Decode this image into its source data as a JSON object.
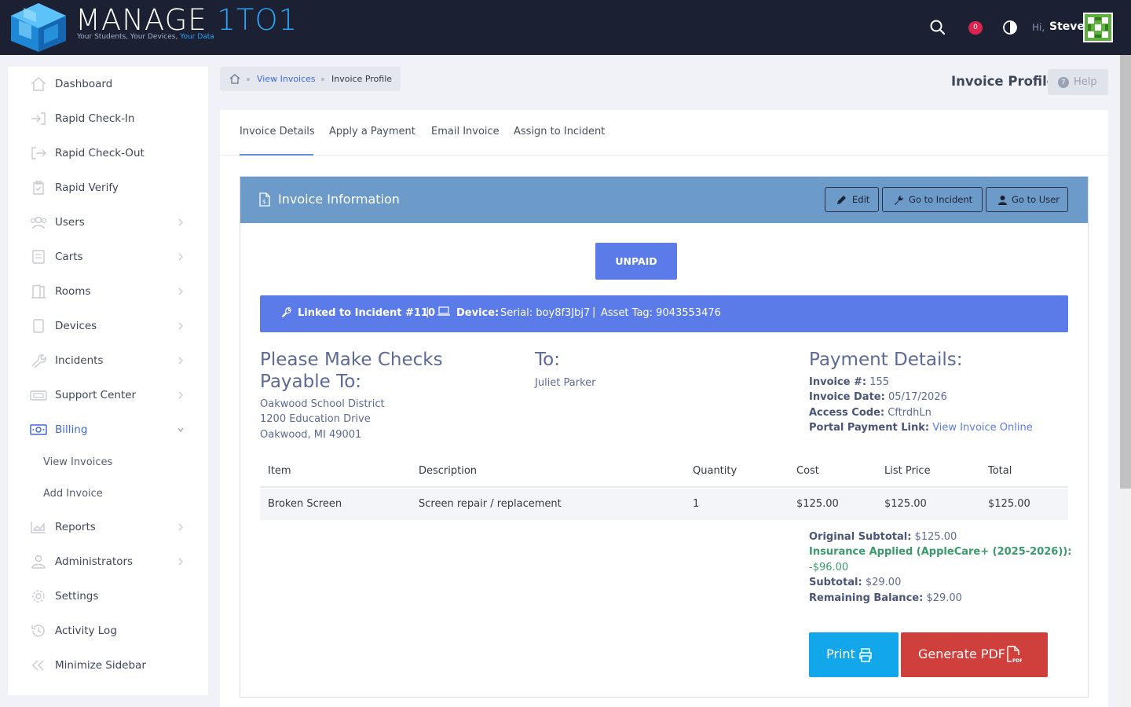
{
  "header": {
    "logo_main": "MANAGE ",
    "logo_accent": "1TO1",
    "logo_tagline": "Your Students, Your Devices, ",
    "logo_tagline_accent": "Your Data",
    "notification_count": "0",
    "greeting": "Hi,",
    "user_name": "Steve"
  },
  "sidebar": {
    "items": [
      {
        "label": "Dashboard",
        "icon": "home-icon",
        "has_children": false
      },
      {
        "label": "Rapid Check-In",
        "icon": "sign-in-icon",
        "has_children": false
      },
      {
        "label": "Rapid Check-Out",
        "icon": "sign-out-icon",
        "has_children": false
      },
      {
        "label": "Rapid Verify",
        "icon": "clipboard-check-icon",
        "has_children": false
      },
      {
        "label": "Users",
        "icon": "users-icon",
        "has_children": true
      },
      {
        "label": "Carts",
        "icon": "cart-icon",
        "has_children": true
      },
      {
        "label": "Rooms",
        "icon": "door-icon",
        "has_children": true
      },
      {
        "label": "Devices",
        "icon": "tablet-icon",
        "has_children": true
      },
      {
        "label": "Incidents",
        "icon": "wrench-icon",
        "has_children": true
      },
      {
        "label": "Support Center",
        "icon": "support-icon",
        "has_children": true
      },
      {
        "label": "Billing",
        "icon": "money-icon",
        "has_children": true,
        "active": true
      },
      {
        "label": "Reports",
        "icon": "chart-area-icon",
        "has_children": true
      },
      {
        "label": "Administrators",
        "icon": "admin-user-icon",
        "has_children": true
      },
      {
        "label": "Settings",
        "icon": "gear-icon",
        "has_children": false
      },
      {
        "label": "Activity Log",
        "icon": "history-icon",
        "has_children": false
      },
      {
        "label": "Minimize Sidebar",
        "icon": "double-chevron-left-icon",
        "has_children": false
      }
    ],
    "billing_sub": [
      "View Invoices",
      "Add Invoice"
    ]
  },
  "breadcrumb": {
    "link": "View Invoices",
    "current": "Invoice Profile"
  },
  "page": {
    "title": "Invoice Profile",
    "help_label": "Help"
  },
  "tabs": [
    "Invoice Details",
    "Apply a Payment",
    "Email Invoice",
    "Assign to Incident"
  ],
  "invoice_panel": {
    "title": "Invoice Information",
    "buttons": {
      "edit": "Edit",
      "incident": "Go to Incident",
      "user": "Go to User"
    },
    "status": "UNPAID",
    "link_bar": {
      "incident": "Linked to Incident #110",
      "sep": "|",
      "device_label": "Device:",
      "serial": "Serial: boy8f3Jbj7",
      "asset": "Asset Tag: 9043553476"
    },
    "payable": {
      "heading": "Please Make Checks Payable To:",
      "line1": "Oakwood School District",
      "line2": "1200 Education Drive",
      "line3": "Oakwood, MI 49001"
    },
    "to": {
      "heading": "To:",
      "name": "Juliet Parker"
    },
    "payment": {
      "heading": "Payment Details:",
      "invoice_no_label": "Invoice #:",
      "invoice_no": "155",
      "date_label": "Invoice Date:",
      "date": "05/17/2026",
      "access_label": "Access Code:",
      "access": "CftrdhLn",
      "portal_label": "Portal Payment Link:",
      "portal_link": "View Invoice Online"
    },
    "table": {
      "headers": [
        "Item",
        "Description",
        "Quantity",
        "Cost",
        "List Price",
        "Total"
      ],
      "rows": [
        [
          "Broken Screen",
          "Screen repair / replacement",
          "1",
          "$125.00",
          "$125.00",
          "$125.00"
        ]
      ]
    },
    "summary": {
      "original_label": "Original Subtotal:",
      "original": "$125.00",
      "insurance_label": "Insurance Applied (AppleCare+ (2025-2026)):",
      "insurance": "-$96.00",
      "subtotal_label": "Subtotal:",
      "subtotal": "$29.00",
      "remaining_label": "Remaining Balance:",
      "remaining": "$29.00"
    },
    "actions": {
      "print": "Print",
      "pdf": "Generate PDF"
    }
  },
  "colors": {
    "topbar": "#1c2033",
    "accent": "#3f6ad8",
    "panel_header": "#6c9ac9",
    "status_blue": "#5b7be9",
    "print": "#12a6ea",
    "pdf": "#cf3f3b",
    "insurance_green": "#3a9a6c"
  }
}
